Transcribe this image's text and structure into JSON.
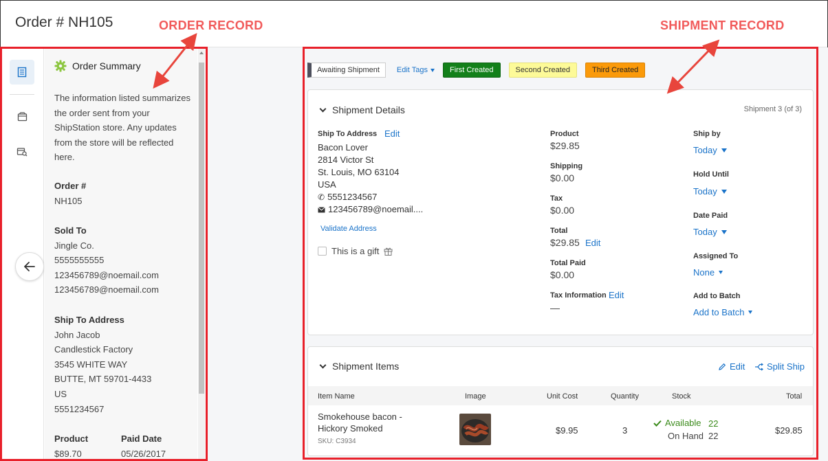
{
  "header": {
    "order_title": "Order # NH105"
  },
  "annotations": {
    "order_record": "ORDER RECORD",
    "shipment_record": "SHIPMENT RECORD"
  },
  "sidebar": {
    "rail_icons": [
      "order-summary-icon",
      "package-icon",
      "order-details-icon"
    ],
    "summary": {
      "title": "Order Summary",
      "description": "The information listed summarizes the order sent from your ShipStation store. Any updates from the store will be reflected here.",
      "order_num_label": "Order #",
      "order_num": "NH105",
      "sold_to_label": "Sold To",
      "sold_to_name": "Jingle Co.",
      "sold_to_phone": "5555555555",
      "sold_to_email1": "123456789@noemail.com",
      "sold_to_email2": "123456789@noemail.com",
      "ship_to_label": "Ship To Address",
      "ship_to_name": "John Jacob",
      "ship_to_company": "Candlestick Factory",
      "ship_to_street": "3545 WHITE WAY",
      "ship_to_city": "BUTTE, MT 59701-4433",
      "ship_to_country": "US",
      "ship_to_phone": "5551234567",
      "product_label": "Product",
      "product_value": "$89.70",
      "paid_date_label": "Paid Date",
      "paid_date_value": "05/26/2017"
    }
  },
  "tags": {
    "status": "Awaiting Shipment",
    "edit_tags": "Edit Tags",
    "items": [
      {
        "label": "First Created",
        "color": "#13801a"
      },
      {
        "label": "Second Created",
        "color": "#fdfa98"
      },
      {
        "label": "Third Created",
        "color": "#fb9a0a"
      }
    ]
  },
  "shipment_details": {
    "title": "Shipment Details",
    "counter": "Shipment 3 (of 3)",
    "ship_to_label": "Ship To Address",
    "edit_label": "Edit",
    "address_lines": [
      "Bacon Lover",
      "2814 Victor St",
      "St. Louis, MO 63104",
      "USA"
    ],
    "phone": "5551234567",
    "email": "123456789@noemail....",
    "validate_address": "Validate Address",
    "gift_label": "This is a gift",
    "product_label": "Product",
    "product_value": "$29.85",
    "shipping_label": "Shipping",
    "shipping_value": "$0.00",
    "tax_label": "Tax",
    "tax_value": "$0.00",
    "total_label": "Total",
    "total_value": "$29.85",
    "total_edit": "Edit",
    "total_paid_label": "Total Paid",
    "total_paid_value": "$0.00",
    "tax_info_label": "Tax Information",
    "tax_info_edit": "Edit",
    "tax_info_value": "—",
    "ship_by_label": "Ship by",
    "ship_by_value": "Today",
    "hold_until_label": "Hold Until",
    "hold_until_value": "Today",
    "date_paid_label": "Date Paid",
    "date_paid_value": "Today",
    "assigned_to_label": "Assigned To",
    "assigned_to_value": "None",
    "add_to_batch_label": "Add to Batch",
    "add_to_batch_value": "Add to Batch"
  },
  "shipment_items": {
    "title": "Shipment Items",
    "edit": "Edit",
    "split_ship": "Split Ship",
    "columns": [
      "Item Name",
      "Image",
      "Unit Cost",
      "Quantity",
      "Stock",
      "Total"
    ],
    "rows": [
      {
        "name_line1": "Smokehouse bacon -",
        "name_line2": "Hickory Smoked",
        "sku": "SKU: C3934",
        "unit_cost": "$9.95",
        "quantity": "3",
        "available_label": "Available",
        "available_count": "22",
        "on_hand_label": "On Hand",
        "on_hand_count": "22",
        "total": "$29.85"
      }
    ]
  }
}
